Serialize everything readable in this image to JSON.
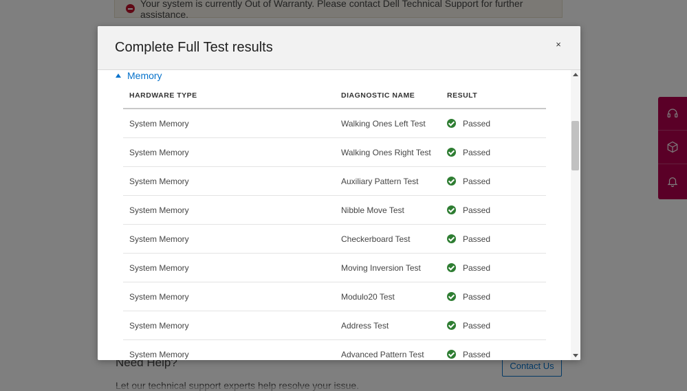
{
  "background": {
    "warranty_message": "Your system is currently Out of Warranty. Please contact Dell Technical Support for further assistance.",
    "need_help": "Need Help?",
    "help_sub": "Let our technical support experts help resolve your issue.",
    "contact_label": "Contact Us"
  },
  "modal": {
    "title": "Complete Full Test results",
    "close_label": "×",
    "section_label": "Memory",
    "columns": {
      "hardware_type": "HARDWARE TYPE",
      "diagnostic_name": "DIAGNOSTIC NAME",
      "result": "RESULT"
    },
    "rows": [
      {
        "hardware": "System Memory",
        "diagnostic": "Walking Ones Left Test",
        "result": "Passed"
      },
      {
        "hardware": "System Memory",
        "diagnostic": "Walking Ones Right Test",
        "result": "Passed"
      },
      {
        "hardware": "System Memory",
        "diagnostic": "Auxiliary Pattern Test",
        "result": "Passed"
      },
      {
        "hardware": "System Memory",
        "diagnostic": "Nibble Move Test",
        "result": "Passed"
      },
      {
        "hardware": "System Memory",
        "diagnostic": "Checkerboard Test",
        "result": "Passed"
      },
      {
        "hardware": "System Memory",
        "diagnostic": "Moving Inversion Test",
        "result": "Passed"
      },
      {
        "hardware": "System Memory",
        "diagnostic": "Modulo20 Test",
        "result": "Passed"
      },
      {
        "hardware": "System Memory",
        "diagnostic": "Address Test",
        "result": "Passed"
      },
      {
        "hardware": "System Memory",
        "diagnostic": "Advanced Pattern Test",
        "result": "Passed"
      }
    ]
  },
  "colors": {
    "accent": "#0672cb",
    "pass": "#2e7d32",
    "side_rail": "#b5004f",
    "warning": "#c0122a"
  }
}
